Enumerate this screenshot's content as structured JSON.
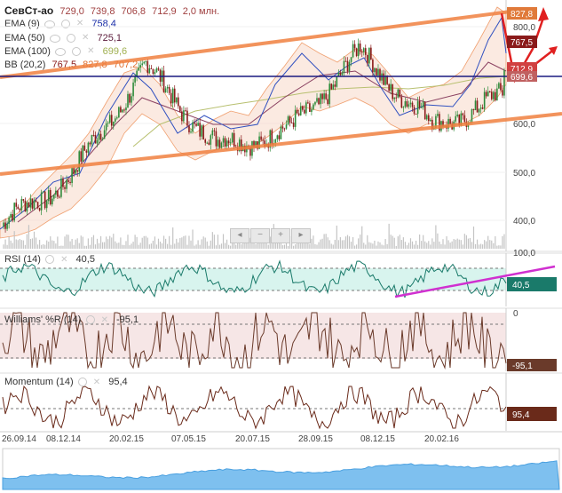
{
  "header": {
    "ticker": "СевСт-ао",
    "open": "729,0",
    "high": "739,8",
    "low": "706,8",
    "close": "712,9",
    "volume": "2,0 млн."
  },
  "indicators": [
    {
      "name": "EMA (9)",
      "value": "758,4",
      "color": "#1a2ea8"
    },
    {
      "name": "EMA (50)",
      "value": "725,1",
      "color": "#5a1a3a"
    },
    {
      "name": "EMA (100)",
      "value": "699,6",
      "color": "#a0b050"
    },
    {
      "name": "BB (20,2)",
      "value": "767,5",
      "value2": "827,8",
      "value3": "707,2",
      "color": "#e07030"
    }
  ],
  "price_axis": {
    "ticks": [
      "800,0",
      "700,0",
      "600,0",
      "500,0",
      "400,0"
    ]
  },
  "price_tags": [
    {
      "text": "827,8",
      "color": "#e07a3a"
    },
    {
      "text": "767,5",
      "color": "#8a1a1a"
    },
    {
      "text": "712,9",
      "color": "#d04040"
    },
    {
      "text": "699,6",
      "color": "#c06060"
    }
  ],
  "zoom_controls": {
    "left": "◂",
    "minus": "−",
    "plus": "+",
    "right": "▸"
  },
  "rsi": {
    "label": "RSI (14)",
    "value": "40,5",
    "tag": "40,5",
    "top_tick": "100,0"
  },
  "williams": {
    "label": "Williams' %R (14)",
    "value": "-95,1",
    "tag": "-95,1",
    "top_tick": "0"
  },
  "momentum": {
    "label": "Momentum (14)",
    "value": "95,4",
    "tag": "95,4"
  },
  "x_axis": {
    "labels": [
      "26.09.14",
      "08.12.14",
      "20.02.15",
      "07.05.15",
      "20.07.15",
      "28.09.15",
      "08.12.15",
      "20.02.16"
    ]
  },
  "colors": {
    "up": "#2e8b3a",
    "down": "#8b1a1a",
    "channel": "#f08040",
    "hline": "#1a1a80",
    "rsi": "#1a7a6a",
    "trend_rsi": "#d030d0",
    "williams": "#6a3a2a",
    "momentum": "#6a2a1a",
    "navigator": "#4aa0e0"
  },
  "chart_data": {
    "type": "line",
    "series": [
      {
        "name": "СевСт-ао",
        "x": [
          "26.09.14",
          "08.12.14",
          "20.02.15",
          "07.05.15",
          "20.07.15",
          "28.09.15",
          "08.12.15",
          "20.02.16"
        ],
        "values": [
          400,
          505,
          720,
          560,
          590,
          750,
          600,
          660
        ]
      }
    ],
    "ylim": [
      380,
      840
    ],
    "last": 712.9
  }
}
